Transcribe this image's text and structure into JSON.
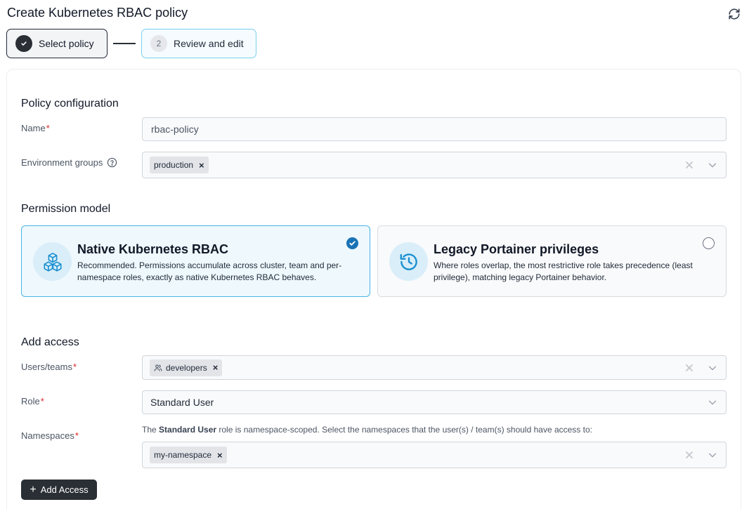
{
  "page": {
    "title": "Create Kubernetes RBAC policy"
  },
  "stepper": {
    "step1": {
      "label": "Select policy",
      "status": "completed"
    },
    "step2": {
      "number": "2",
      "label": "Review and edit",
      "status": "active"
    }
  },
  "policy_config": {
    "title": "Policy configuration",
    "name_label": "Name",
    "name_value": "rbac-policy",
    "env_groups_label": "Environment groups",
    "env_groups_chips": [
      "production"
    ]
  },
  "permission_model": {
    "title": "Permission model",
    "native": {
      "title": "Native Kubernetes RBAC",
      "description": "Recommended. Permissions accumulate across cluster, team and per-namespace roles, exactly as native Kubernetes RBAC behaves.",
      "selected": true
    },
    "legacy": {
      "title": "Legacy Portainer privileges",
      "description": "Where roles overlap, the most restrictive role takes precedence (least privilege), matching legacy Portainer behavior.",
      "selected": false
    }
  },
  "add_access": {
    "title": "Add access",
    "users_label": "Users/teams",
    "users_chips": [
      "developers"
    ],
    "role_label": "Role",
    "role_value": "Standard User",
    "namespaces_label": "Namespaces",
    "help_prefix": "The ",
    "help_bold": "Standard User",
    "help_suffix": " role is namespace-scoped. Select the namespaces that the user(s) / team(s) should have access to:",
    "namespaces_chips": [
      "my-namespace"
    ],
    "add_button_label": "Add Access"
  },
  "colors": {
    "accent": "#48b6e6",
    "selected_check": "#1a73b5",
    "dark_button": "#2a2f35",
    "required": "#dc2626"
  },
  "icons": [
    "refresh-icon",
    "check-icon",
    "help-circle-icon",
    "chip-remove-icon",
    "clear-icon",
    "chevron-down-icon",
    "cubes-icon",
    "history-icon",
    "users-icon",
    "plus-icon"
  ]
}
